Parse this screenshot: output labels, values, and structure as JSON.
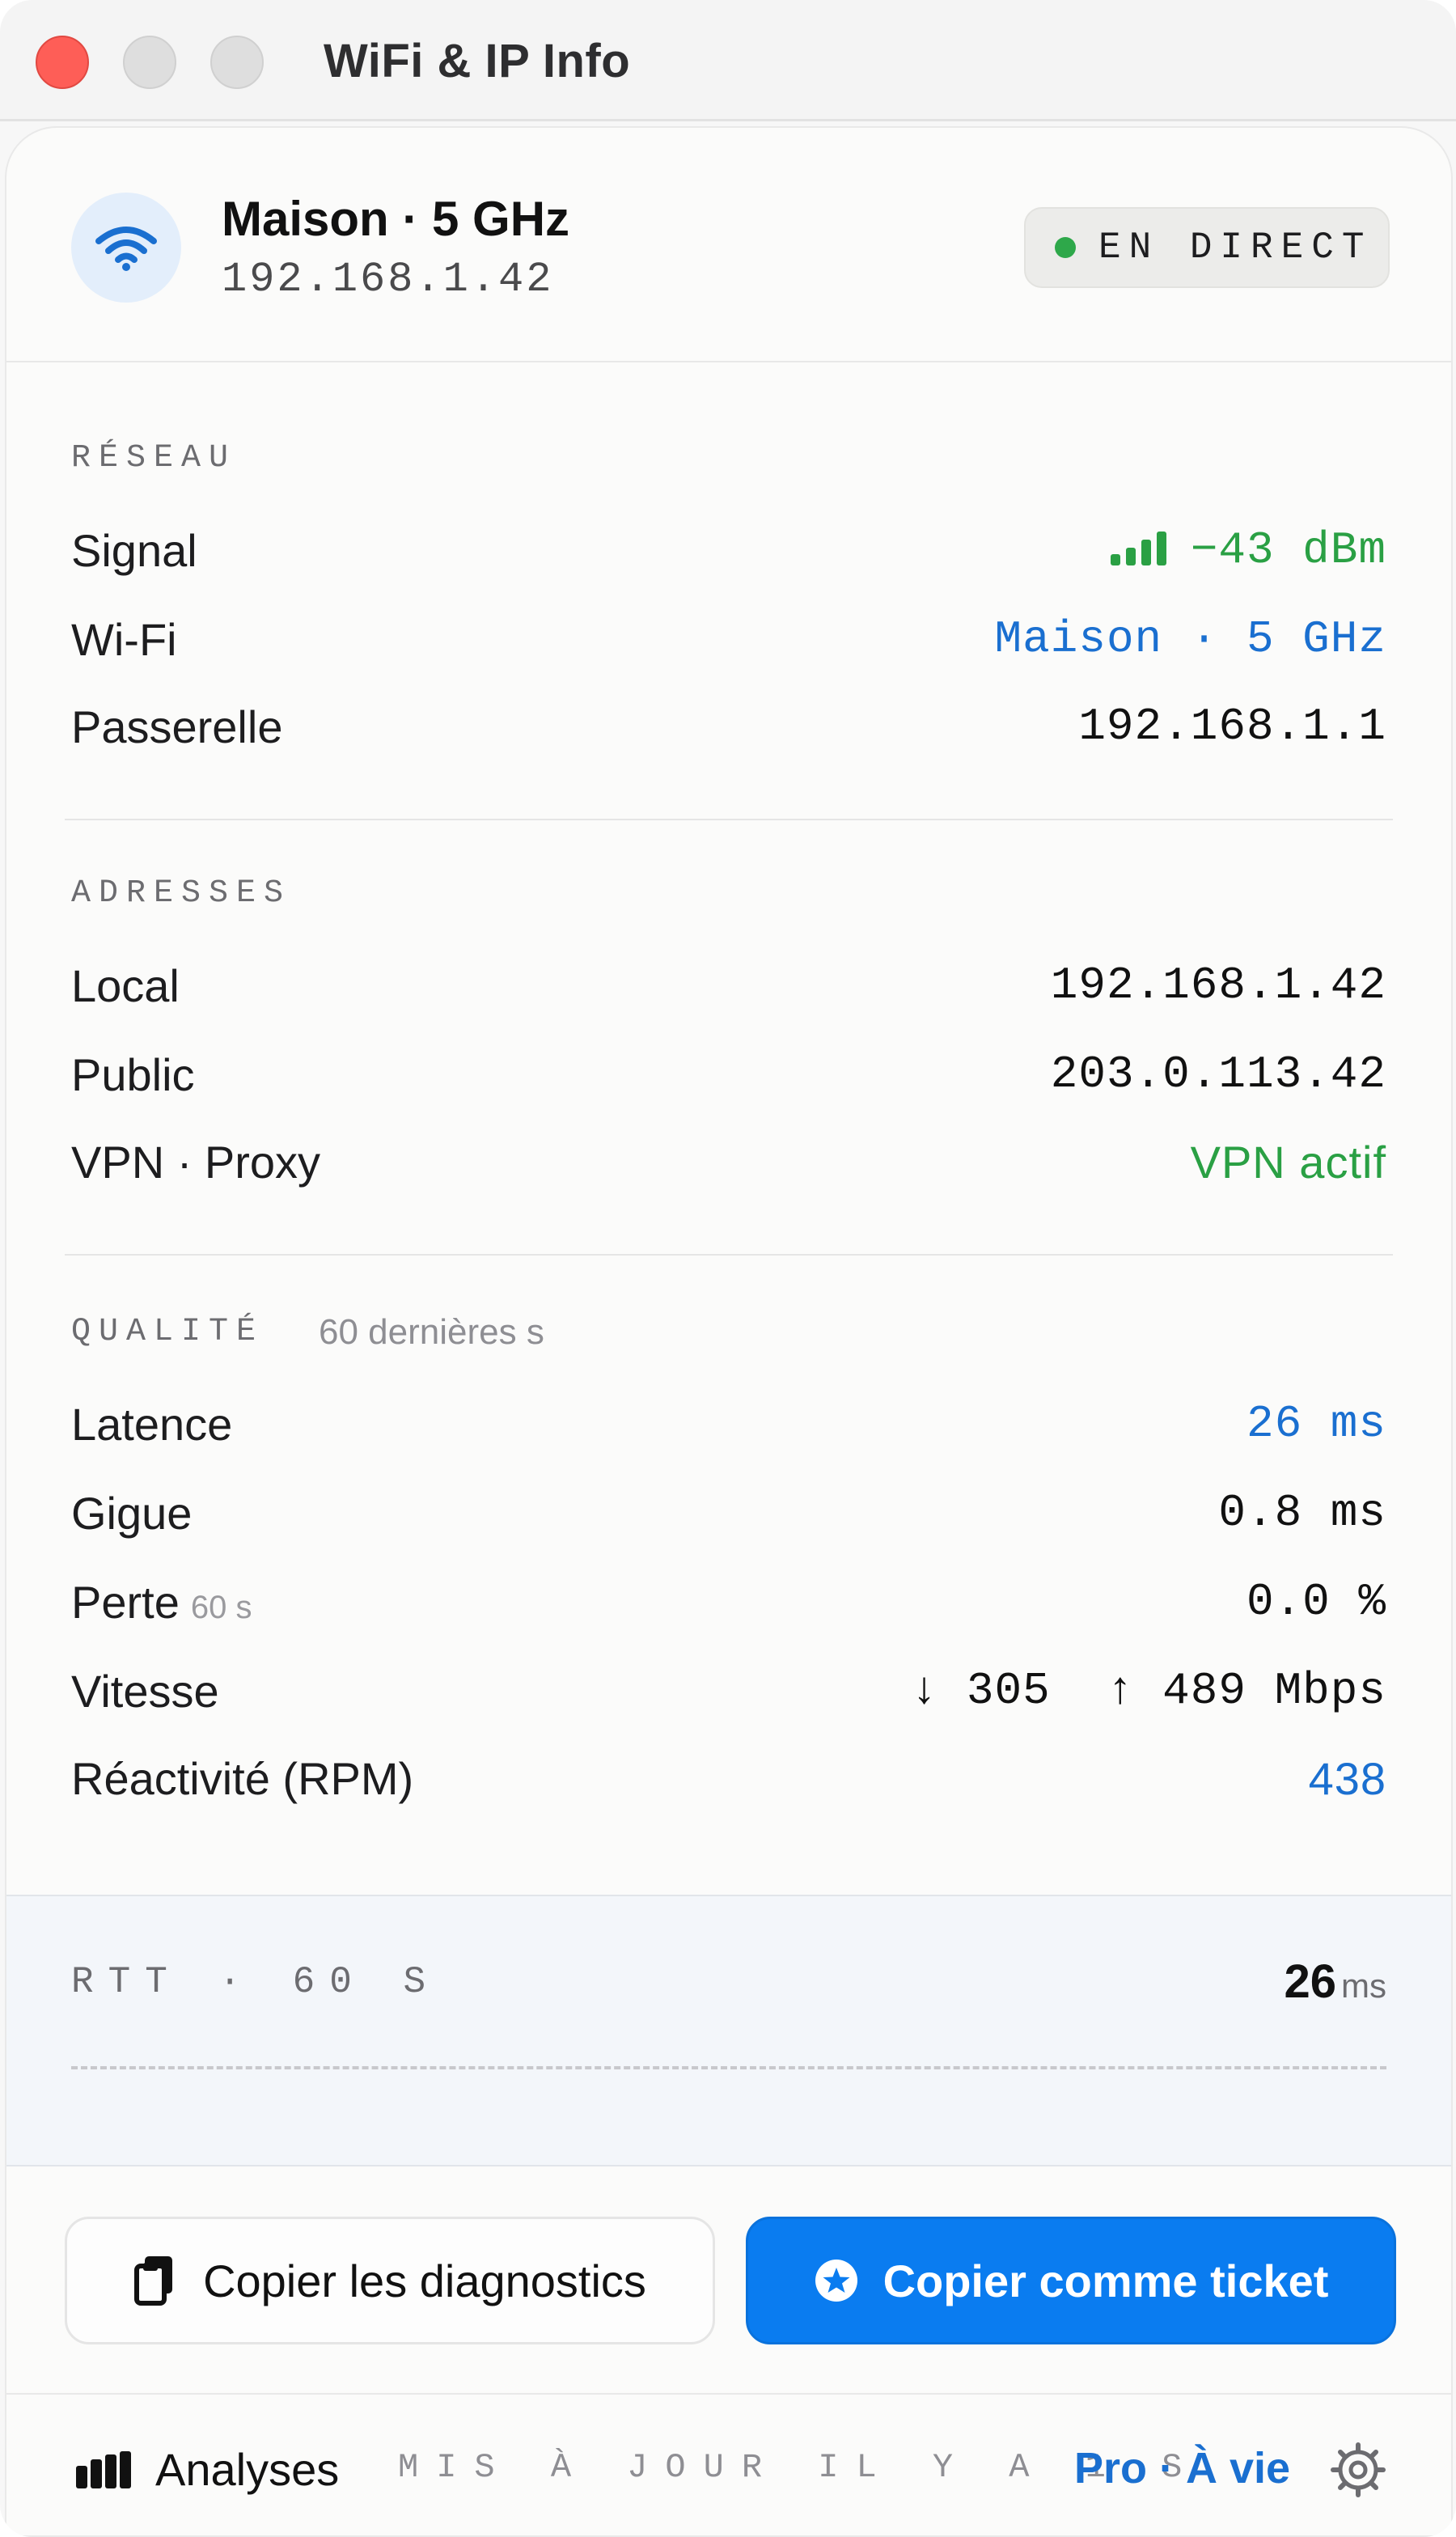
{
  "window": {
    "title": "WiFi & IP Info"
  },
  "header": {
    "network_name": "Maison · 5 GHz",
    "ip": "192.168.1.42",
    "live_label": "EN DIRECT"
  },
  "sections": {
    "reseau": {
      "title": "RÉSEAU",
      "rows": [
        {
          "label": "Signal",
          "value": "−43 dBm",
          "bars": 4
        },
        {
          "label": "Wi-Fi",
          "value": "Maison · 5 GHz"
        },
        {
          "label": "Passerelle",
          "value": "192.168.1.1"
        }
      ]
    },
    "adresses": {
      "title": "ADRESSES",
      "rows": [
        {
          "label": "Local",
          "value": "192.168.1.42"
        },
        {
          "label": "Public",
          "value": "203.0.113.42"
        },
        {
          "label": "VPN · Proxy",
          "value": "VPN actif"
        }
      ]
    },
    "qualite": {
      "title": "QUALITÉ",
      "subtitle": "60 dernières s",
      "rows": [
        {
          "label": "Latence",
          "value": "26 ms"
        },
        {
          "label": "Gigue",
          "value": "0.8 ms"
        },
        {
          "label": "Perte",
          "sublabel": "60 s",
          "value": "0.0 %"
        },
        {
          "label": "Vitesse",
          "value": "↓ 305  ↑ 489 Mbps"
        },
        {
          "label": "Réactivité (RPM)",
          "value": "438"
        }
      ]
    }
  },
  "rtt": {
    "title": "RTT · 60 S",
    "value": "26",
    "unit": "ms"
  },
  "buttons": {
    "copy_diagnostics": "Copier les diagnostics",
    "copy_ticket": "Copier comme ticket"
  },
  "footer": {
    "analyses": "Analyses",
    "updated": "MIS À JOUR IL Y A 1 S",
    "plan": "Pro · À vie"
  },
  "colors": {
    "green": "#2aa044",
    "blue": "#1a6fd0",
    "accent_button": "#0a7cf0",
    "close": "#fe5e57"
  }
}
